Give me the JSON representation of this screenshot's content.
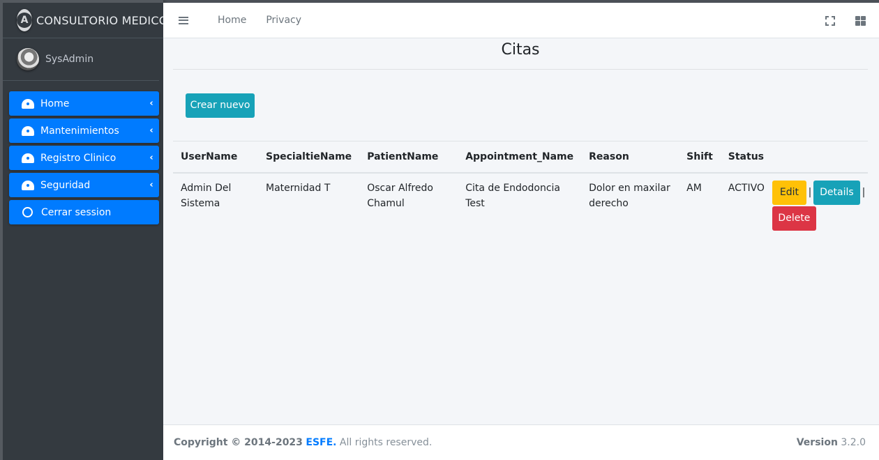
{
  "brand": {
    "logo_letter": "A",
    "title": "CONSULTORIO MEDICO"
  },
  "user": {
    "name": "SysAdmin"
  },
  "sidebar": {
    "items": [
      {
        "label": "Home",
        "icon": "tachometer-icon"
      },
      {
        "label": "Mantenimientos",
        "icon": "tachometer-icon"
      },
      {
        "label": "Registro Clinico",
        "icon": "tachometer-icon"
      },
      {
        "label": "Seguridad",
        "icon": "tachometer-icon"
      },
      {
        "label": "Cerrar session",
        "icon": "circle-icon"
      }
    ],
    "chevron": "‹"
  },
  "topbar": {
    "links": [
      "Home",
      "Privacy"
    ]
  },
  "page": {
    "title": "Citas",
    "create_label": "Crear nuevo"
  },
  "table": {
    "headers": [
      "UserName",
      "SpecialtieName",
      "PatientName",
      "Appointment_Name",
      "Reason",
      "Shift",
      "Status"
    ],
    "rows": [
      {
        "cells": [
          "Admin Del Sistema",
          "Maternidad T",
          "Oscar Alfredo Chamul",
          "Cita de Endodoncia Test",
          "Dolor en maxilar derecho",
          "AM",
          "ACTIVO"
        ],
        "actions": {
          "edit": "Edit",
          "details": "Details",
          "delete": "Delete",
          "separator": "|"
        }
      }
    ]
  },
  "footer": {
    "copyright_prefix": "Copyright © 2014-2023",
    "company": "ESFE.",
    "rights": "All rights reserved.",
    "version_label": "Version",
    "version": "3.2.0"
  },
  "colors": {
    "primary": "#007bff",
    "info": "#17a2b8",
    "warning": "#ffc107",
    "danger": "#dc3545",
    "sidebar": "#343a40"
  }
}
